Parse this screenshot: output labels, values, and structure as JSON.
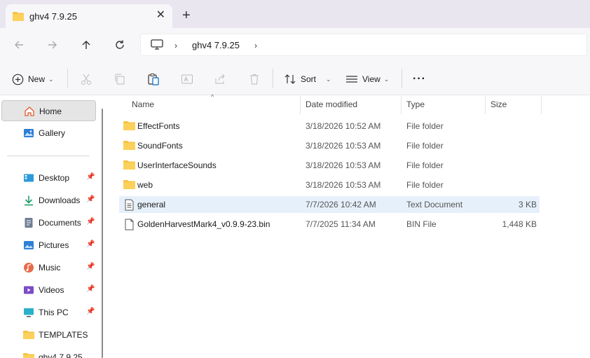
{
  "window": {
    "tab_title": "ghv4 7.9.25",
    "close_glyph": "✕",
    "new_tab_glyph": "+"
  },
  "address": {
    "segments": [
      "ghv4 7.9.25"
    ],
    "separator": "›"
  },
  "toolbar": {
    "new_label": "New",
    "sort_label": "Sort",
    "view_label": "View",
    "more_label": "···"
  },
  "sidebar": {
    "items": [
      {
        "label": "Home",
        "icon": "home-icon",
        "pinned": false,
        "active": true
      },
      {
        "label": "Gallery",
        "icon": "gallery-icon",
        "pinned": false
      },
      {
        "label": "Desktop",
        "icon": "desktop-icon",
        "pinned": true
      },
      {
        "label": "Downloads",
        "icon": "downloads-icon",
        "pinned": true
      },
      {
        "label": "Documents",
        "icon": "documents-icon",
        "pinned": true
      },
      {
        "label": "Pictures",
        "icon": "pictures-icon",
        "pinned": true
      },
      {
        "label": "Music",
        "icon": "music-icon",
        "pinned": true
      },
      {
        "label": "Videos",
        "icon": "videos-icon",
        "pinned": true
      },
      {
        "label": "This PC",
        "icon": "pc-icon",
        "pinned": true
      },
      {
        "label": "TEMPLATES",
        "icon": "folder-icon",
        "pinned": false
      },
      {
        "label": "ghv4 7.9.25",
        "icon": "folder-icon",
        "pinned": false
      }
    ]
  },
  "columns": {
    "name": "Name",
    "date": "Date modified",
    "type": "Type",
    "size": "Size"
  },
  "files": [
    {
      "name": "EffectFonts",
      "date": "3/18/2026 10:52 AM",
      "type": "File folder",
      "size": "",
      "icon": "folder-icon"
    },
    {
      "name": "SoundFonts",
      "date": "3/18/2026 10:53 AM",
      "type": "File folder",
      "size": "",
      "icon": "folder-icon"
    },
    {
      "name": "UserInterfaceSounds",
      "date": "3/18/2026 10:53 AM",
      "type": "File folder",
      "size": "",
      "icon": "folder-icon"
    },
    {
      "name": "web",
      "date": "3/18/2026 10:53 AM",
      "type": "File folder",
      "size": "",
      "icon": "folder-icon"
    },
    {
      "name": "general",
      "date": "7/7/2026 10:42 AM",
      "type": "Text Document",
      "size": "3 KB",
      "icon": "text-file-icon",
      "selected": true
    },
    {
      "name": "GoldenHarvestMark4_v0.9.9-23.bin",
      "date": "7/7/2025 11:34 AM",
      "type": "BIN File",
      "size": "1,448 KB",
      "icon": "file-icon"
    }
  ],
  "colors": {
    "folder": "#f6c343",
    "accent": "#0067c0",
    "selected_row": "#e6f0fa"
  }
}
